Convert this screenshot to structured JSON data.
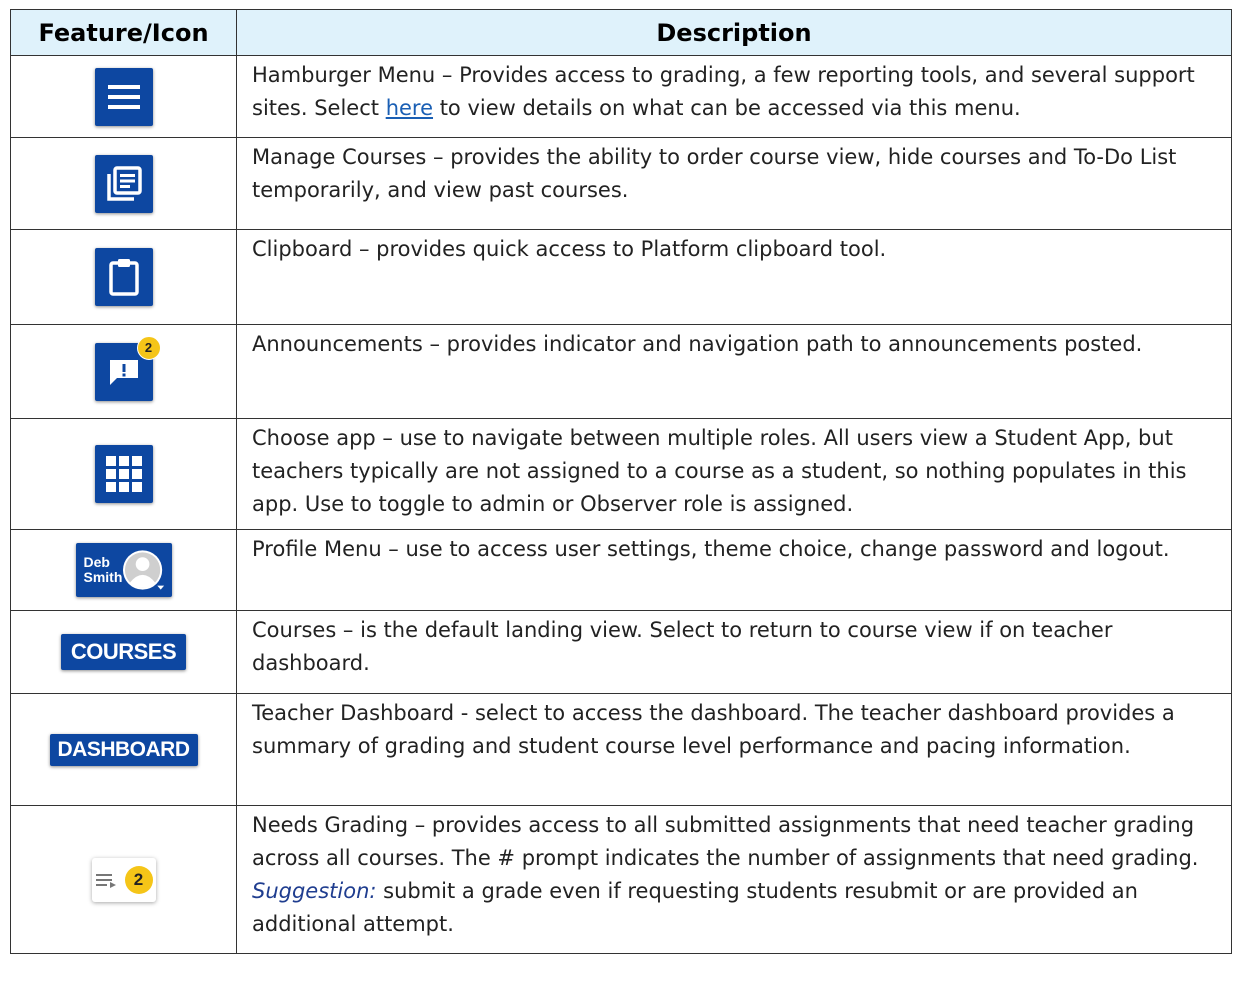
{
  "table": {
    "header_feature": "Feature/Icon",
    "header_description": "Description"
  },
  "rows": [
    {
      "icon": "hamburger-menu-icon",
      "desc_before": "Hamburger Menu – Provides access to grading, a few reporting tools, and several support sites. Select ",
      "link_text": "here",
      "desc_after": " to view details on what can be accessed via this menu."
    },
    {
      "icon": "manage-courses-icon",
      "desc": "Manage Courses – provides the ability to order course view, hide courses and To-Do List temporarily, and view past courses."
    },
    {
      "icon": "clipboard-icon",
      "desc": "Clipboard – provides quick access to Platform clipboard tool."
    },
    {
      "icon": "announcements-icon",
      "badge": "2",
      "desc": "Announcements – provides indicator and navigation path to announcements posted."
    },
    {
      "icon": "app-grid-icon",
      "desc": "Choose app – use to navigate between multiple roles. All users view a Student App, but teachers typically are not assigned to a course as a student, so nothing populates in this app. Use to toggle to admin or Observer role is assigned."
    },
    {
      "icon": "avatar-icon",
      "profile_first": "Deb",
      "profile_last": "Smith",
      "desc": "Profile Menu – use to access user settings, theme choice, change password and logout."
    },
    {
      "button_label": "COURSES",
      "desc": "Courses – is the default landing view. Select to return to course view if on teacher dashboard."
    },
    {
      "button_label": "DASHBOARD",
      "desc": "Teacher Dashboard - select to access the dashboard. The teacher dashboard provides a summary of grading and student course level performance and pacing information."
    },
    {
      "icon": "needs-grading-icon",
      "badge": "2",
      "desc_before": "Needs Grading – provides access to all submitted assignments that need teacher grading across all courses. The # prompt indicates the number of assignments that need grading. ",
      "suggestion_label": "Suggestion:",
      "desc_after": " submit a grade even if requesting students resubmit or are provided an additional attempt."
    }
  ],
  "colors": {
    "header_bg": "#dff2fb",
    "brand_blue": "#0d47a1",
    "badge_yellow": "#f5c518",
    "link_blue": "#1a5fb4"
  }
}
